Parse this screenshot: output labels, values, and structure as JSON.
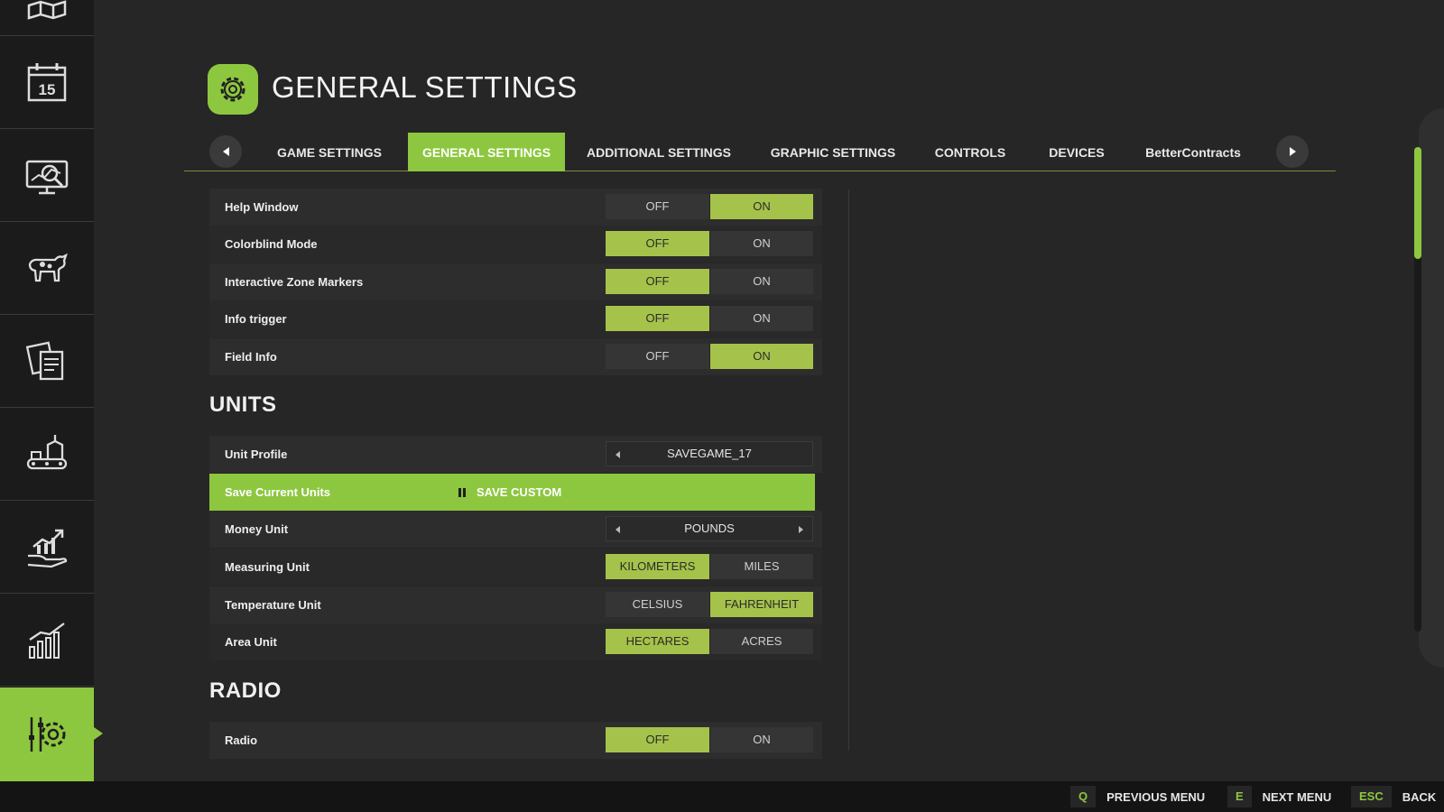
{
  "sidebar": {
    "items": [
      {
        "icon": "map-icon"
      },
      {
        "icon": "calendar-icon",
        "day": "15"
      },
      {
        "icon": "prices-icon"
      },
      {
        "icon": "animals-icon"
      },
      {
        "icon": "contracts-icon"
      },
      {
        "icon": "production-icon"
      },
      {
        "icon": "finances-icon"
      },
      {
        "icon": "statistics-icon"
      },
      {
        "icon": "settings-icon",
        "active": true
      }
    ]
  },
  "header": {
    "title": "GENERAL SETTINGS",
    "icon": "gear-icon"
  },
  "tabs": [
    {
      "label": "GAME SETTINGS"
    },
    {
      "label": "GENERAL SETTINGS",
      "active": true
    },
    {
      "label": "ADDITIONAL SETTINGS"
    },
    {
      "label": "GRAPHIC SETTINGS"
    },
    {
      "label": "CONTROLS"
    },
    {
      "label": "DEVICES"
    },
    {
      "label": "BetterContracts"
    }
  ],
  "general": [
    {
      "label": "Help Window",
      "off": "OFF",
      "on": "ON",
      "value": "ON"
    },
    {
      "label": "Colorblind Mode",
      "off": "OFF",
      "on": "ON",
      "value": "OFF"
    },
    {
      "label": "Interactive Zone Markers",
      "off": "OFF",
      "on": "ON",
      "value": "OFF"
    },
    {
      "label": "Info trigger",
      "off": "OFF",
      "on": "ON",
      "value": "OFF"
    },
    {
      "label": "Field Info",
      "off": "OFF",
      "on": "ON",
      "value": "ON"
    }
  ],
  "units": {
    "title": "UNITS",
    "unit_profile": {
      "label": "Unit Profile",
      "value": "SAVEGAME_17"
    },
    "save_current": {
      "label": "Save Current Units",
      "button": "SAVE CUSTOM"
    },
    "money_unit": {
      "label": "Money Unit",
      "value": "POUNDS"
    },
    "measuring_unit": {
      "label": "Measuring Unit",
      "a": "KILOMETERS",
      "b": "MILES",
      "value": "KILOMETERS"
    },
    "temperature_unit": {
      "label": "Temperature Unit",
      "a": "CELSIUS",
      "b": "FAHRENHEIT",
      "value": "FAHRENHEIT"
    },
    "area_unit": {
      "label": "Area Unit",
      "a": "HECTARES",
      "b": "ACRES",
      "value": "HECTARES"
    }
  },
  "radio": {
    "title": "RADIO",
    "radio": {
      "label": "Radio",
      "off": "OFF",
      "on": "ON",
      "value": "OFF"
    }
  },
  "footer": {
    "prev": {
      "key": "Q",
      "label": "PREVIOUS MENU"
    },
    "next": {
      "key": "E",
      "label": "NEXT MENU"
    },
    "back": {
      "key": "ESC",
      "label": "BACK"
    }
  },
  "colors": {
    "accent": "#8dc73f",
    "toggle_on": "#a5c24a",
    "background": "#262626"
  }
}
